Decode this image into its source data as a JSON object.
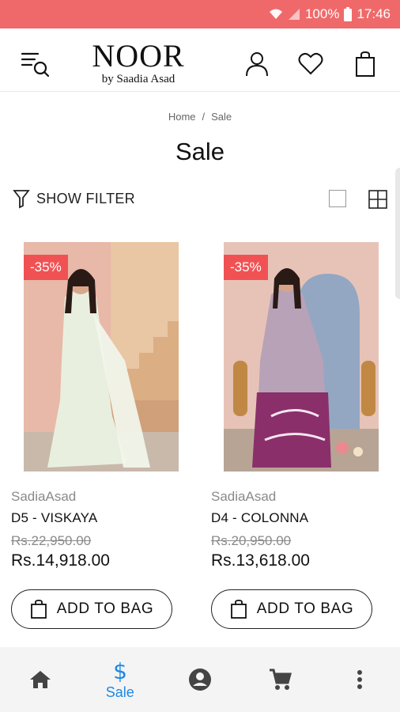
{
  "status_bar": {
    "battery": "100%",
    "time": "17:46"
  },
  "header": {
    "brand_name": "NOOR",
    "brand_sub": "by Saadia Asad"
  },
  "breadcrumb": {
    "home": "Home",
    "separator": "/",
    "current": "Sale"
  },
  "page": {
    "title": "Sale"
  },
  "filter": {
    "label": "SHOW FILTER"
  },
  "products": [
    {
      "discount": "-35%",
      "vendor": "SadiaAsad",
      "name": "D5 - VISKAYA",
      "old_price": "Rs.22,950.00",
      "price": "Rs.14,918.00",
      "button": "ADD TO BAG"
    },
    {
      "discount": "-35%",
      "vendor": "SadiaAsad",
      "name": "D4 - COLONNA",
      "old_price": "Rs.20,950.00",
      "price": "Rs.13,618.00",
      "button": "ADD TO BAG"
    }
  ],
  "bottom_nav": {
    "items": [
      {
        "icon": "home-icon",
        "label": ""
      },
      {
        "icon": "dollar-icon",
        "label": "Sale"
      },
      {
        "icon": "account-icon",
        "label": ""
      },
      {
        "icon": "cart-icon",
        "label": ""
      },
      {
        "icon": "more-vertical-icon",
        "label": ""
      }
    ],
    "active_color": "#1e88e5"
  },
  "colors": {
    "status_bar": "#f0696a",
    "discount_badge": "#f05253"
  }
}
